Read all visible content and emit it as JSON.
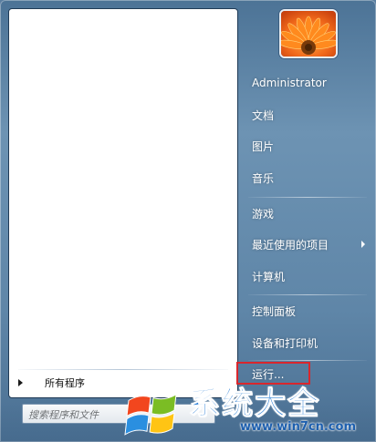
{
  "left_panel": {
    "all_programs_label": "所有程序",
    "search_placeholder": "搜索程序和文件"
  },
  "user": {
    "avatar_icon": "flower-avatar-icon"
  },
  "right_panel": {
    "items": [
      {
        "label": "Administrator",
        "has_submenu": false
      },
      {
        "label": "文档",
        "has_submenu": false
      },
      {
        "label": "图片",
        "has_submenu": false
      },
      {
        "label": "音乐",
        "has_submenu": false
      },
      {
        "label": "游戏",
        "has_submenu": false
      },
      {
        "label": "最近使用的项目",
        "has_submenu": true
      },
      {
        "label": "计算机",
        "has_submenu": false
      },
      {
        "label": "控制面板",
        "has_submenu": false
      },
      {
        "label": "设备和打印机",
        "has_submenu": false
      },
      {
        "label": "运行...",
        "has_submenu": false
      }
    ]
  },
  "highlight": {
    "color": "#d9262c",
    "target": "运行..."
  },
  "watermark": {
    "title": "系统大全",
    "url": "www.win7cn.com",
    "logo_icon": "windows-flag-icon"
  }
}
